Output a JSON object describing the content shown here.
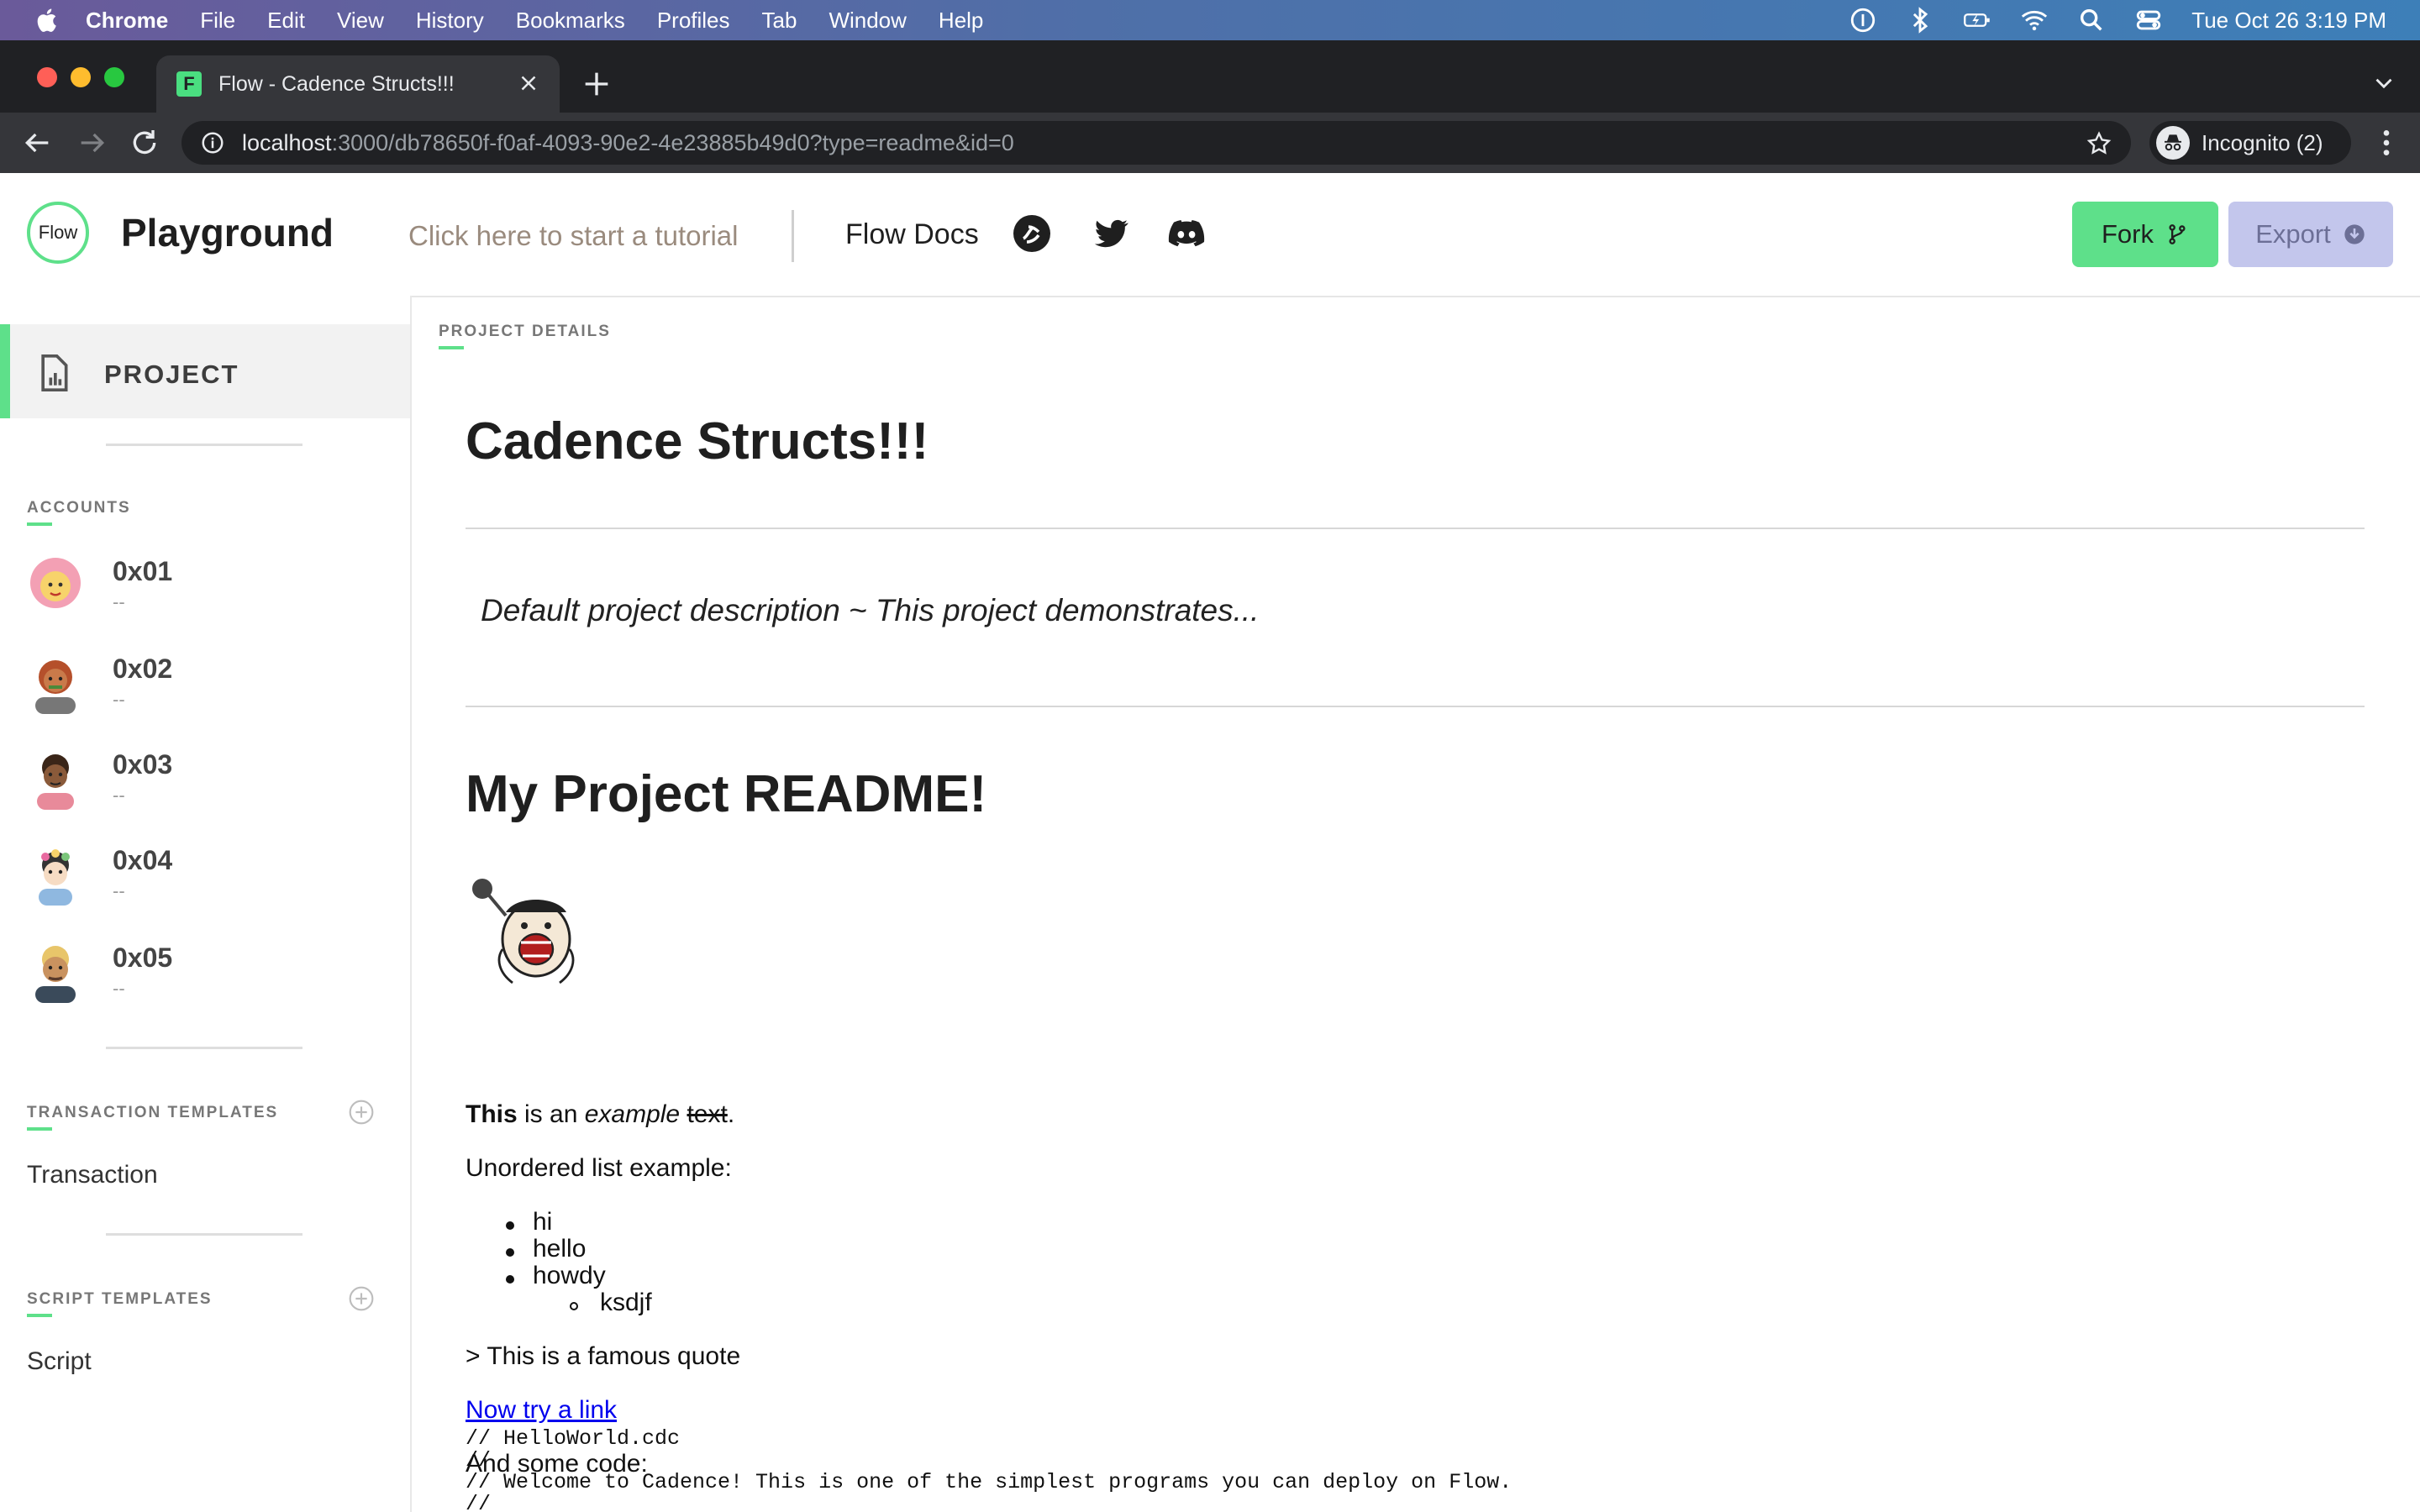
{
  "menubar": {
    "app": "Chrome",
    "items": [
      "File",
      "Edit",
      "View",
      "History",
      "Bookmarks",
      "Profiles",
      "Tab",
      "Window",
      "Help"
    ],
    "clock": "Tue Oct 26  3:19 PM"
  },
  "browser": {
    "tab_title": "Flow - Cadence Structs!!!",
    "tab_favicon": "F",
    "url_host": "localhost",
    "url_rest": ":3000/db78650f-f0af-4093-90e2-4e23885b49d0?type=readme&id=0",
    "incognito_label": "Incognito (2)"
  },
  "header": {
    "logo": "Flow",
    "title": "Playground",
    "tutorial": "Click here to start a tutorial",
    "docs": "Flow Docs",
    "fork_label": "Fork",
    "export_label": "Export",
    "colors": {
      "accent": "#5ee08a",
      "export_bg": "#c3c6ec"
    }
  },
  "sidebar": {
    "project_label": "PROJECT",
    "accounts_heading": "ACCOUNTS",
    "accounts": [
      {
        "address": "0x01",
        "sub": "--"
      },
      {
        "address": "0x02",
        "sub": "--"
      },
      {
        "address": "0x03",
        "sub": "--"
      },
      {
        "address": "0x04",
        "sub": "--"
      },
      {
        "address": "0x05",
        "sub": "--"
      }
    ],
    "tx_heading": "TRANSACTION TEMPLATES",
    "tx_items": [
      "Transaction"
    ],
    "script_heading": "SCRIPT TEMPLATES",
    "script_items": [
      "Script"
    ]
  },
  "main": {
    "section_label": "PROJECT DETAILS",
    "project_title": "Cadence Structs!!!",
    "description": "Default project description ~ This project demonstrates...",
    "readme_heading": "My Project README!",
    "para1": {
      "bold": "This",
      "mid": " is an ",
      "italic": "example",
      "space": " ",
      "strike": "text",
      "end": "."
    },
    "list_intro": "Unordered list example:",
    "list": [
      "hi",
      "hello",
      "howdy"
    ],
    "sublist": [
      "ksdjf"
    ],
    "quote": "> This is a famous quote",
    "link_text": "Now try a link",
    "code_intro": "And some code:",
    "code_lines": [
      "// HelloWorld.cdc",
      "//",
      "// Welcome to Cadence! This is one of the simplest programs you can deploy on Flow.",
      "//"
    ]
  }
}
